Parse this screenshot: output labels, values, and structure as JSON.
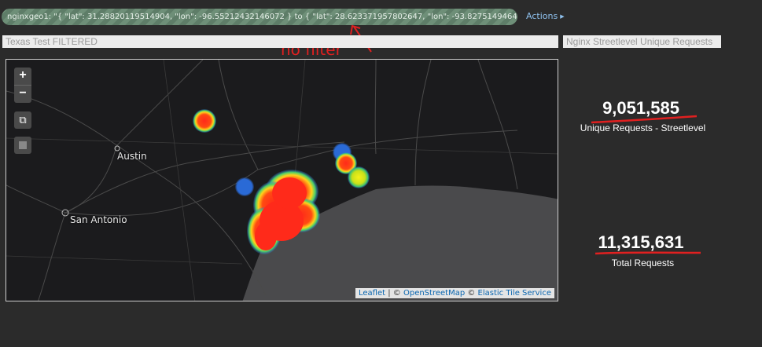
{
  "filter": {
    "text": "nginxgeo1: \"{ \"lat\": 31.28820119514904, \"lon\": -96.55212432146072 } to { \"lat\": 28.623371957802647, \"lon\": -93.82751494646072 }\"",
    "actions_label": "Actions"
  },
  "annotation": {
    "text": "no filter"
  },
  "panels": {
    "map_title": "Texas Test FILTERED",
    "metric_title": "Nginx Streetlevel Unique Requests"
  },
  "map": {
    "zoom_in": "+",
    "zoom_out": "−",
    "cities": [
      "Austin",
      "San Antonio"
    ],
    "attribution": {
      "leaflet": "Leaflet",
      "sep1": " | © ",
      "osm": "OpenStreetMap",
      "sep2": " © ",
      "ets": "Elastic Tile Service"
    }
  },
  "metrics": [
    {
      "value": "9,051,585",
      "label": "Unique Requests - Streetlevel"
    },
    {
      "value": "11,315,631",
      "label": "Total Requests"
    }
  ],
  "colors": {
    "annotation_red": "#e02020",
    "link_blue": "#8fc1ee",
    "heat_red": "#ff2a1a"
  }
}
